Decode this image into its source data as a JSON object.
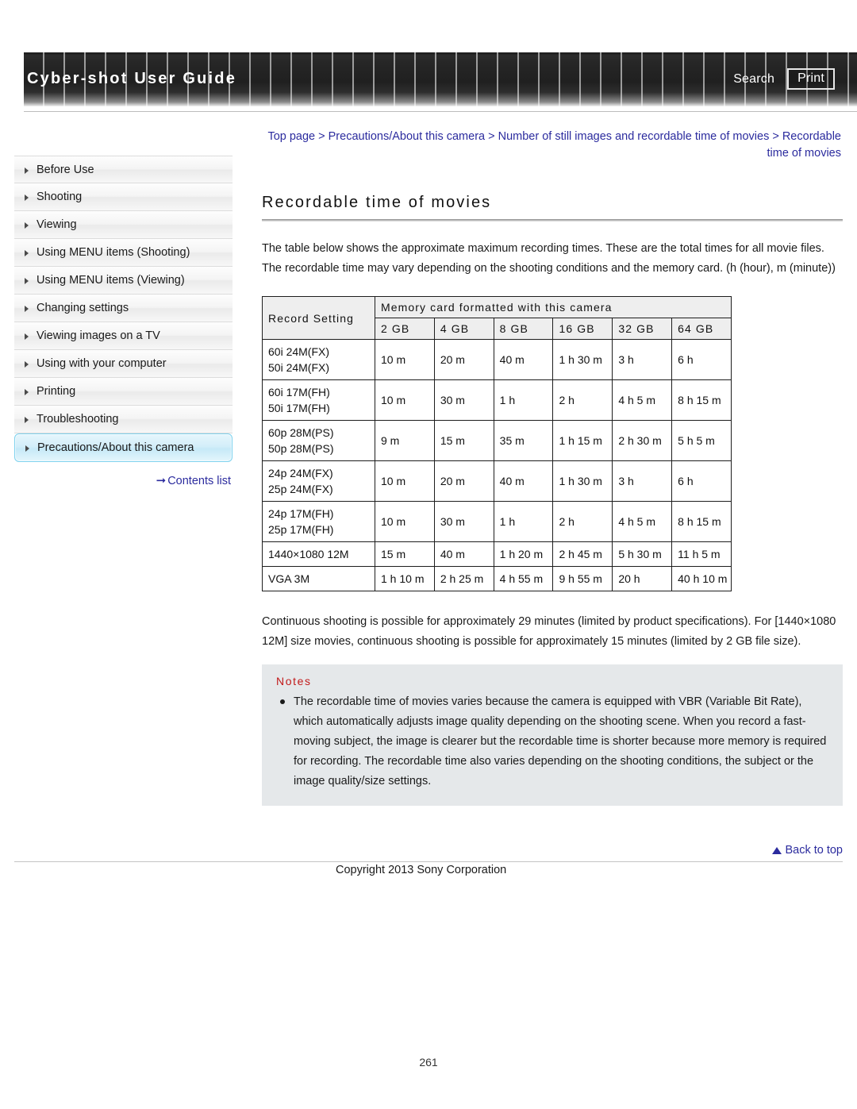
{
  "header": {
    "title": "Cyber-shot User Guide",
    "search_label": "Search",
    "print_label": "Print"
  },
  "breadcrumb": {
    "text": "Top page > Precautions/About this camera > Number of still images and recordable time of movies > Recordable time of movies"
  },
  "sidebar": {
    "items": [
      {
        "label": "Before Use",
        "active": false
      },
      {
        "label": "Shooting",
        "active": false
      },
      {
        "label": "Viewing",
        "active": false
      },
      {
        "label": "Using MENU items (Shooting)",
        "active": false
      },
      {
        "label": "Using MENU items (Viewing)",
        "active": false
      },
      {
        "label": "Changing settings",
        "active": false
      },
      {
        "label": "Viewing images on a TV",
        "active": false
      },
      {
        "label": "Using with your computer",
        "active": false
      },
      {
        "label": "Printing",
        "active": false
      },
      {
        "label": "Troubleshooting",
        "active": false
      },
      {
        "label": "Precautions/About this camera",
        "active": true
      }
    ],
    "contents_list_label": "Contents list",
    "contents_list_icon": "right-arrow-icon"
  },
  "main": {
    "title": "Recordable time of movies",
    "intro": "The table below shows the approximate maximum recording times. These are the total times for all movie files. The recordable time may vary depending on the shooting conditions and the memory card. (h (hour), m (minute))",
    "after_table": "Continuous shooting is possible for approximately 29 minutes (limited by product specifications). For [1440×1080 12M] size movies, continuous shooting is possible for approximately 15 minutes (limited by 2 GB file size)."
  },
  "table": {
    "group_header": "Memory card formatted with this camera",
    "setting_header": "Record Setting",
    "capacity_headers": [
      "2 GB",
      "4 GB",
      "8 GB",
      "16 GB",
      "32 GB",
      "64 GB"
    ],
    "rows": [
      {
        "setting": [
          "60i 24M(FX)",
          "50i 24M(FX)"
        ],
        "values": [
          "10 m",
          "20 m",
          "40 m",
          "1 h 30 m",
          "3 h",
          "6 h"
        ]
      },
      {
        "setting": [
          "60i 17M(FH)",
          "50i 17M(FH)"
        ],
        "values": [
          "10 m",
          "30 m",
          "1 h",
          "2 h",
          "4 h 5 m",
          "8 h 15 m"
        ]
      },
      {
        "setting": [
          "60p 28M(PS)",
          "50p 28M(PS)"
        ],
        "values": [
          "9 m",
          "15 m",
          "35 m",
          "1 h 15 m",
          "2 h 30 m",
          "5 h 5 m"
        ]
      },
      {
        "setting": [
          "24p 24M(FX)",
          "25p 24M(FX)"
        ],
        "values": [
          "10 m",
          "20 m",
          "40 m",
          "1 h 30 m",
          "3 h",
          "6 h"
        ]
      },
      {
        "setting": [
          "24p 17M(FH)",
          "25p 17M(FH)"
        ],
        "values": [
          "10 m",
          "30 m",
          "1 h",
          "2 h",
          "4 h 5 m",
          "8 h 15 m"
        ]
      },
      {
        "setting": [
          "1440×1080 12M"
        ],
        "values": [
          "15 m",
          "40 m",
          "1 h 20 m",
          "2 h 45 m",
          "5 h 30 m",
          "11 h 5 m"
        ]
      },
      {
        "setting": [
          "VGA 3M"
        ],
        "values": [
          "1 h 10 m",
          "2 h 25 m",
          "4 h 55 m",
          "9 h 55 m",
          "20 h",
          "40 h 10 m"
        ]
      }
    ]
  },
  "notes": {
    "title": "Notes",
    "items": [
      "The recordable time of movies varies because the camera is equipped with VBR (Variable Bit Rate), which automatically adjusts image quality depending on the shooting scene. When you record a fast-moving subject, the image is clearer but the recordable time is shorter because more memory is required for recording. The recordable time also varies depending on the shooting conditions, the subject or the image quality/size settings."
    ]
  },
  "footer": {
    "back_to_top_label": "Back to top",
    "back_to_top_icon": "up-triangle-icon",
    "copyright": "Copyright 2013 Sony Corporation",
    "page_number": "261"
  },
  "colors": {
    "link": "#2b2b9e",
    "notes_title": "#c21a1a",
    "notes_bg": "#e5e8ea",
    "active_sidebar": "#c6e9f7"
  }
}
